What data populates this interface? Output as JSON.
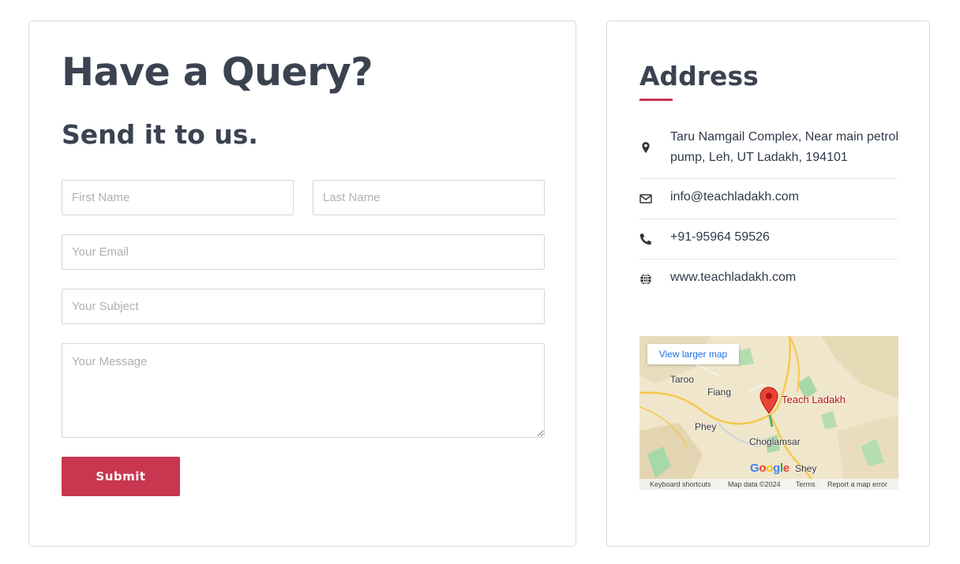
{
  "form": {
    "title": "Have a Query?",
    "subtitle": "Send it to us.",
    "first_name_placeholder": "First Name",
    "last_name_placeholder": "Last Name",
    "email_placeholder": "Your Email",
    "subject_placeholder": "Your Subject",
    "message_placeholder": "Your Message",
    "submit_label": "Submit"
  },
  "address": {
    "title": "Address",
    "accent_color": "#c8364f",
    "items": [
      {
        "icon": "map-marker-icon",
        "text": "Taru Namgail Complex, Near main petrol pump, Leh, UT Ladakh, 194101"
      },
      {
        "icon": "envelope-icon",
        "text": "info@teachladakh.com"
      },
      {
        "icon": "phone-icon",
        "text": "+91-95964 59526"
      },
      {
        "icon": "globe-icon",
        "text": "www.teachladakh.com"
      }
    ]
  },
  "map": {
    "view_larger": "View larger map",
    "place_name": "Teach Ladakh",
    "labels": {
      "taroo": "Taroo",
      "fiang": "Fiang",
      "phey": "Phey",
      "choglamsar": "Choglamsar",
      "shey": "Shey"
    },
    "footer": {
      "shortcuts": "Keyboard shortcuts",
      "map_data": "Map data ©2024",
      "terms": "Terms",
      "report": "Report a map error"
    }
  }
}
